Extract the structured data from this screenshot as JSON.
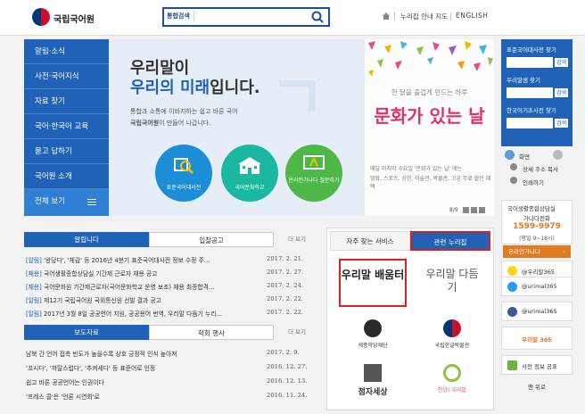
{
  "header": {
    "logo_text": "국립국어원",
    "search_label": "통합검색",
    "search_value": "",
    "util_links": [
      "누리집 안내 지도",
      "ENGLISH"
    ]
  },
  "menu": {
    "items": [
      "알림·소식",
      "사전·국어지식",
      "자료 찾기",
      "국어·한국어 교육",
      "묻고 답하기",
      "국어원 소개"
    ],
    "all_label": "전체 보기"
  },
  "hero": {
    "line1": "우리말이",
    "line2_highlight": "우리의 미래",
    "line2_rest": "입니다.",
    "desc1": "통합과 소통에 이바지하는 쉽고 바른 국어",
    "desc2_strong": "국립국어원",
    "desc2_rest": "이 만들어 나갑니다.",
    "circles": [
      "표준국어대사전",
      "국어문화학교",
      "온라인가나다 질문하기"
    ]
  },
  "promo": {
    "subtitle": "한 달을 즐겁게 만드는 하루",
    "title": "문화가 있는 날",
    "desc1": "매달 마지막 수요일 '문화가 있는 날' 에는",
    "desc2": "영화, 스포츠, 공연, 미술관, 박물관, 고궁 무료·할인 혜택",
    "page": "8/9"
  },
  "right": {
    "dict1": "표준국어대사전 찾기",
    "dict2": "우리말샘 찾기",
    "dict3": "한국어기초사전 찾기",
    "search_btn": "검색",
    "tools": [
      "화면",
      "상세 주소 복사",
      "인쇄하기"
    ],
    "consult_title": "국어생활종합상담실",
    "consult_sub": "가나다전화",
    "consult_phone": "1599-9979",
    "consult_hours": "(평일 9~18시)",
    "online": "온라인가나다",
    "sns": [
      "@우리말365",
      "@urimal365",
      "@urimal365",
      "우리말 365",
      "사전 정보 공표"
    ],
    "top": "맨 위로"
  },
  "notice": {
    "tabs": [
      "알립니다",
      "입찰공고"
    ],
    "more": "더 보기",
    "rows": [
      {
        "tag": "[알림]",
        "text": " '왕당다', '체감' 등 2016년 4분기 표준국어대사전 정보 수정 주...",
        "date": "2017. 2. 21."
      },
      {
        "tag": "[채용]",
        "text": " 국어생활종합상담실 기간제 근로자 채용 공고",
        "date": "2017. 2. 27."
      },
      {
        "tag": "[채용]",
        "text": " 국어문화원 기간제근로자(국어문화학교 운영 보조) 채용 최종합격...",
        "date": "2017. 2. 24."
      },
      {
        "tag": "[알림]",
        "text": " 제12기 국립국어원 국외통신원 선발 결과 공고",
        "date": "2017. 2. 22."
      },
      {
        "tag": "[알림]",
        "text": " 2017년 3월 8일 공공언어 지원, 공공용어 번역, 우리말 다듬기 누리...",
        "date": "2017. 2. 22."
      }
    ]
  },
  "press": {
    "tabs": [
      "보도자료",
      "학회 행사"
    ],
    "more": "더 보기",
    "rows": [
      {
        "text": "남북 간 언어 접촉 빈도가 높을수록 상호 긍정적 인식 높아져",
        "date": "2017. 2. 9."
      },
      {
        "text": "'꼬시다', '까탈스럽다', '추켜세다' 등 표준어로 인정",
        "date": "2016. 12. 27."
      },
      {
        "text": "쉽고 바른 공공언어는 인권이다",
        "date": "2016. 12. 13."
      },
      {
        "text": "'프레스 콜'은 '언론 시연회'로",
        "date": "2016. 11. 24."
      }
    ]
  },
  "services": {
    "tabs": [
      "자주 찾는 서비스",
      "관련 누리집"
    ],
    "logos": [
      "우리말 배움터",
      "우리말 다듬기",
      "세종학당재단",
      "국립한글박물관",
      "점자세상",
      "안녕! 우리말"
    ]
  }
}
